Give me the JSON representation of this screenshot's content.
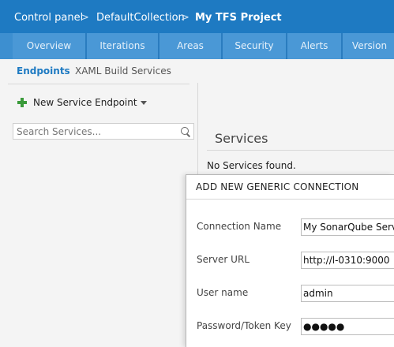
{
  "breadcrumb": {
    "items": [
      "Control panel",
      "DefaultCollection",
      "My TFS Project"
    ],
    "separator": ">"
  },
  "tabs": [
    "Overview",
    "Iterations",
    "Areas",
    "Security",
    "Alerts",
    "Version"
  ],
  "subnav": {
    "active": "Endpoints",
    "inactive": "XAML Build Services"
  },
  "left": {
    "new_button": "New Service Endpoint",
    "search_placeholder": "Search Services..."
  },
  "services": {
    "title": "Services",
    "empty_text": "No Services found."
  },
  "dialog": {
    "title": "ADD NEW GENERIC CONNECTION",
    "fields": [
      {
        "label": "Connection Name",
        "value": "My SonarQube Serve"
      },
      {
        "label": "Server URL",
        "value": "http://l-0310:9000"
      },
      {
        "label": "User name",
        "value": "admin"
      },
      {
        "label": "Password/Token Key",
        "value": "●●●●●"
      }
    ]
  },
  "colors": {
    "topbar": "#1e7ac2",
    "tabbar": "#3d8fd0",
    "accent": "#1e7ac2",
    "plus": "#3a9a3a"
  },
  "icons": [
    "plus-icon",
    "caret-down-icon",
    "search-icon"
  ]
}
